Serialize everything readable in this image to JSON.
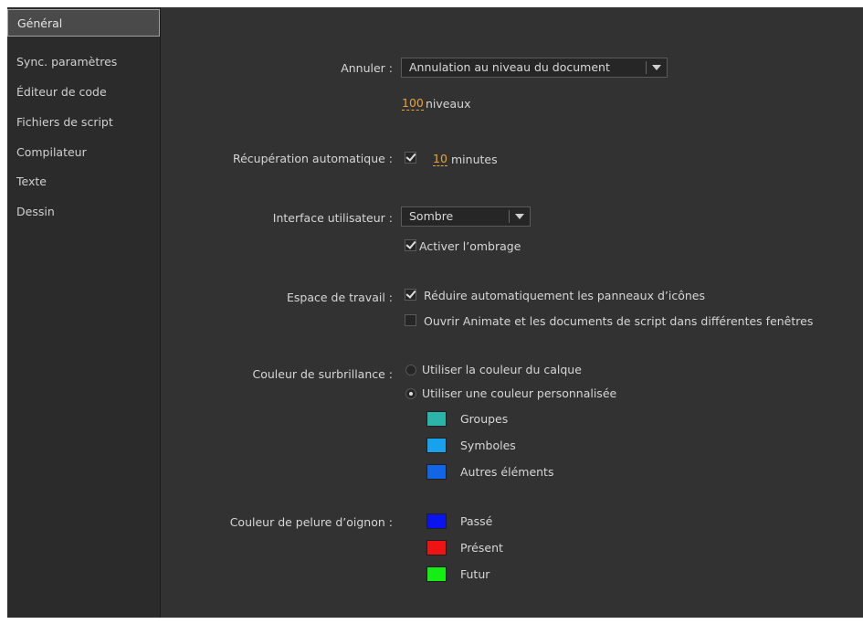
{
  "sidebar": {
    "items": [
      {
        "label": "Général"
      },
      {
        "label": "Sync. paramètres"
      },
      {
        "label": "Éditeur de code"
      },
      {
        "label": "Fichiers de script"
      },
      {
        "label": "Compilateur"
      },
      {
        "label": "Texte"
      },
      {
        "label": "Dessin"
      }
    ]
  },
  "undo": {
    "label": "Annuler :",
    "select_value": "Annulation au niveau du document",
    "levels_value": "100",
    "levels_unit": "niveaux"
  },
  "autorecovery": {
    "label": "Récupération automatique :",
    "checked": true,
    "minutes_value": "10",
    "minutes_unit": "minutes"
  },
  "ui": {
    "label": "Interface utilisateur :",
    "select_value": "Sombre",
    "shading_label": "Activer l’ombrage",
    "shading_checked": true
  },
  "workspace": {
    "label": "Espace de travail :",
    "option1_label": "Réduire automatiquement les panneaux d’icônes",
    "option1_checked": true,
    "option2_label": "Ouvrir Animate et les documents de script dans différentes fenêtres",
    "option2_checked": false
  },
  "highlight": {
    "label": "Couleur de surbrillance :",
    "radio1_label": "Utiliser la couleur du calque",
    "radio2_label": "Utiliser une couleur personnalisée",
    "selected": 2,
    "swatches": [
      {
        "label": "Groupes",
        "color": "#2bb5a8"
      },
      {
        "label": "Symboles",
        "color": "#18a2ec"
      },
      {
        "label": "Autres éléments",
        "color": "#1266e6"
      }
    ]
  },
  "onion": {
    "label": "Couleur de pelure d’oignon :",
    "swatches": [
      {
        "label": "Passé",
        "color": "#0a14ee"
      },
      {
        "label": "Présent",
        "color": "#ee1414"
      },
      {
        "label": "Futur",
        "color": "#14ee14"
      }
    ]
  }
}
